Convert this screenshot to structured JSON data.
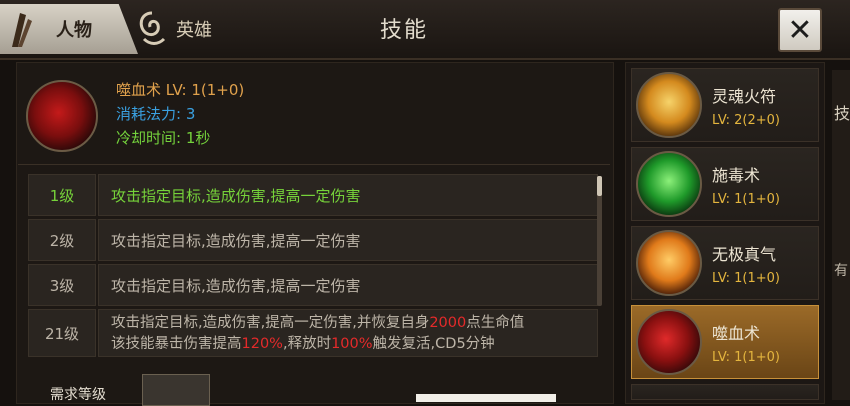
{
  "header": {
    "tab_people": "人物",
    "tab_hero": "英雄",
    "title": "技能",
    "close_label": "✕"
  },
  "skill": {
    "name_level": "噬血术 LV: 1(1+0)",
    "mana_cost": "消耗法力: 3",
    "cooldown": "冷却时间: 1秒"
  },
  "levels": [
    {
      "level": "1级",
      "desc": "攻击指定目标,造成伤害,提高一定伤害",
      "active": true
    },
    {
      "level": "2级",
      "desc": "攻击指定目标,造成伤害,提高一定伤害",
      "active": false
    },
    {
      "level": "3级",
      "desc": "攻击指定目标,造成伤害,提高一定伤害",
      "active": false
    }
  ],
  "level21": {
    "level": "21级",
    "line1_a": "攻击指定目标,造成伤害,提高一定伤害,并恢复自身",
    "line1_hp": "2000",
    "line1_b": "点生命值",
    "line2_a": "该技能暴击伤害提高",
    "line2_pct1": "120%",
    "line2_b": ",释放时",
    "line2_pct2": "100%",
    "line2_c": "触发复活,CD5分钟"
  },
  "requirement": {
    "label": "需求等级"
  },
  "skill_list": [
    {
      "name": "灵魂火符",
      "lv": "LV: 2(2+0)",
      "icon": "fire-talisman-icon",
      "color": "#e8a628"
    },
    {
      "name": "施毒术",
      "lv": "LV: 1(1+0)",
      "icon": "poison-icon",
      "color": "#3ac24a"
    },
    {
      "name": "无极真气",
      "lv": "LV: 1(1+0)",
      "icon": "taiji-energy-icon",
      "color": "#e07a1a"
    },
    {
      "name": "噬血术",
      "lv": "LV: 1(1+0)",
      "icon": "blood-drain-icon",
      "color": "#c41a1a",
      "selected": true
    }
  ],
  "edge_text": {
    "c1": "技",
    "c2": "有"
  },
  "colors": {
    "accent_gold": "#e0a14c",
    "mana_blue": "#3aa0e0",
    "active_green": "#76d23a",
    "highlight_red": "#e42a2a"
  }
}
